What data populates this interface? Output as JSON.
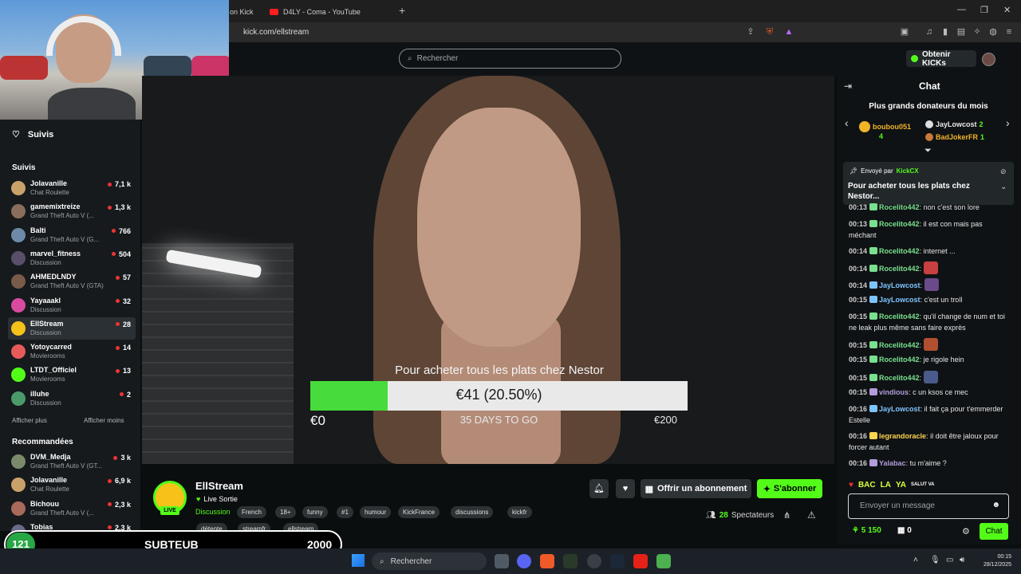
{
  "browser": {
    "tabs": [
      {
        "label": "on Kick"
      },
      {
        "label": "D4LY - Coma - YouTube"
      }
    ],
    "url": "kick.com/ellstream"
  },
  "header": {
    "search_placeholder": "Rechercher",
    "kicks_button": "Obtenir KICKs"
  },
  "sidebar": {
    "title": "Suivis",
    "followed_label": "Suivis",
    "followed": [
      {
        "name": "Jolavanille",
        "category": "Chat Roulette",
        "viewers": "7,1 k",
        "color": "#c9a26a"
      },
      {
        "name": "gamemixtreize",
        "category": "Grand Theft Auto V (...",
        "viewers": "1,3 k",
        "color": "#8a6d5c"
      },
      {
        "name": "Balti",
        "category": "Grand Theft Auto V (G...",
        "viewers": "766",
        "color": "#6d8aa8"
      },
      {
        "name": "marvel_fitness",
        "category": "Discussion",
        "viewers": "504",
        "color": "#5a4f6b"
      },
      {
        "name": "AHMEDLNDY",
        "category": "Grand Theft Auto V (GTA)",
        "viewers": "57",
        "color": "#7a5a48"
      },
      {
        "name": "Yayaaakl",
        "category": "Discussion",
        "viewers": "32",
        "color": "#d84aa0"
      },
      {
        "name": "EllStream",
        "category": "Discussion",
        "viewers": "28",
        "color": "#f6c21a"
      },
      {
        "name": "Yotoycarred",
        "category": "Movierooms",
        "viewers": "14",
        "color": "#e85a5a"
      },
      {
        "name": "LTDT_Officiel",
        "category": "Movierooms",
        "viewers": "13",
        "color": "#53fc18"
      },
      {
        "name": "illuhe",
        "category": "Discussion",
        "viewers": "2",
        "color": "#4a9a6a"
      }
    ],
    "show_more": "Afficher plus",
    "show_less": "Afficher moins",
    "recommended_label": "Recommandées",
    "recommended": [
      {
        "name": "DVM_Medja",
        "category": "Grand Theft Auto V (GT...",
        "viewers": "3 k",
        "color": "#7a8a6a"
      },
      {
        "name": "Jolavanille",
        "category": "Chat Roulette",
        "viewers": "6,9 k",
        "color": "#c9a26a"
      },
      {
        "name": "Bichouu",
        "category": "Grand Theft Auto V (...",
        "viewers": "2,3 k",
        "color": "#a86a5a"
      },
      {
        "name": "Tobias",
        "category": "Grand Theft Auto V (...",
        "viewers": "2,3 k",
        "color": "#6a6a8a"
      }
    ]
  },
  "goal": {
    "title": "Pour acheter tous les plats chez Nestor",
    "current": "€41 (20.50%)",
    "progress": 0.205,
    "start": "€0",
    "days": "35 DAYS TO GO",
    "target": "€200"
  },
  "stream": {
    "name": "EllStream",
    "title": "Live Sortie",
    "live_label": "LIVE",
    "category": "Discussion",
    "tags": [
      "French",
      "18+",
      "funny",
      "#1",
      "humour",
      "KickFrance",
      "discussions",
      "kickfr",
      "détente",
      "streamfr",
      "ellstream"
    ],
    "gift_label": "Offrir un abonnement",
    "subscribe_label": "S'abonner",
    "viewers_count": "28",
    "viewers_label": "Spectateurs"
  },
  "overlay": {
    "count": "121",
    "label": "SUBTEUB",
    "value": "2000"
  },
  "chat": {
    "title": "Chat",
    "donors_title": "Plus grands donateurs du mois",
    "donors": [
      {
        "name": "boubou051",
        "amount": "4",
        "color": "#f0b429"
      },
      {
        "name": "JayLowcost",
        "amount": "2",
        "color": "#e8e8e8"
      },
      {
        "name": "BadJokerFR",
        "amount": "1",
        "color": "#f0b429"
      }
    ],
    "pinned_by_label": "Envoyé par",
    "pinned_by_user": "KickCX",
    "pinned_message": "Pour acheter tous les plats chez Nestor...",
    "messages": [
      {
        "time": "00:13",
        "user": "Rocelito442",
        "color": "#78e08f",
        "text": "non c'est son lore"
      },
      {
        "time": "00:13",
        "user": "Rocelito442",
        "color": "#78e08f",
        "text": "il est con mais pas méchant"
      },
      {
        "time": "00:14",
        "user": "Rocelito442",
        "color": "#78e08f",
        "text": "internet ..."
      },
      {
        "time": "00:14",
        "user": "Rocelito442",
        "color": "#78e08f",
        "text": ""
      },
      {
        "time": "00:14",
        "user": "JayLowcost",
        "color": "#7dc4ff",
        "text": ""
      },
      {
        "time": "00:15",
        "user": "JayLowcost",
        "color": "#7dc4ff",
        "text": "c'est un troll"
      },
      {
        "time": "00:15",
        "user": "Rocelito442",
        "color": "#78e08f",
        "text": "qu'il change de num et toi ne leak plus même sans faire exprès"
      },
      {
        "time": "00:15",
        "user": "Rocelito442",
        "color": "#78e08f",
        "text": ""
      },
      {
        "time": "00:15",
        "user": "Rocelito442",
        "color": "#78e08f",
        "text": "je rigole hein"
      },
      {
        "time": "00:15",
        "user": "Rocelito442",
        "color": "#78e08f",
        "text": ""
      },
      {
        "time": "00:15",
        "user": "vindious",
        "color": "#b39ddb",
        "text": "c un ksos ce mec"
      },
      {
        "time": "00:16",
        "user": "JayLowcost",
        "color": "#7dc4ff",
        "text": "il fait ça pour t'emmerder Estelle"
      },
      {
        "time": "00:16",
        "user": "legrandoracle",
        "color": "#ffd54f",
        "text": "il doit être jaloux pour forcer autant"
      },
      {
        "time": "00:16",
        "user": "Yalabac",
        "color": "#b39ddb",
        "text": "tu m'aime ?"
      }
    ],
    "emote_texts": [
      "BAC",
      "LA",
      "YA",
      "SALUT VA"
    ],
    "input_placeholder": "Envoyer un message",
    "points": "5 150",
    "gifts": "0",
    "send_label": "Chat"
  },
  "taskbar": {
    "search_placeholder": "Rechercher",
    "time": "00:15",
    "date": "28/12/2025"
  }
}
